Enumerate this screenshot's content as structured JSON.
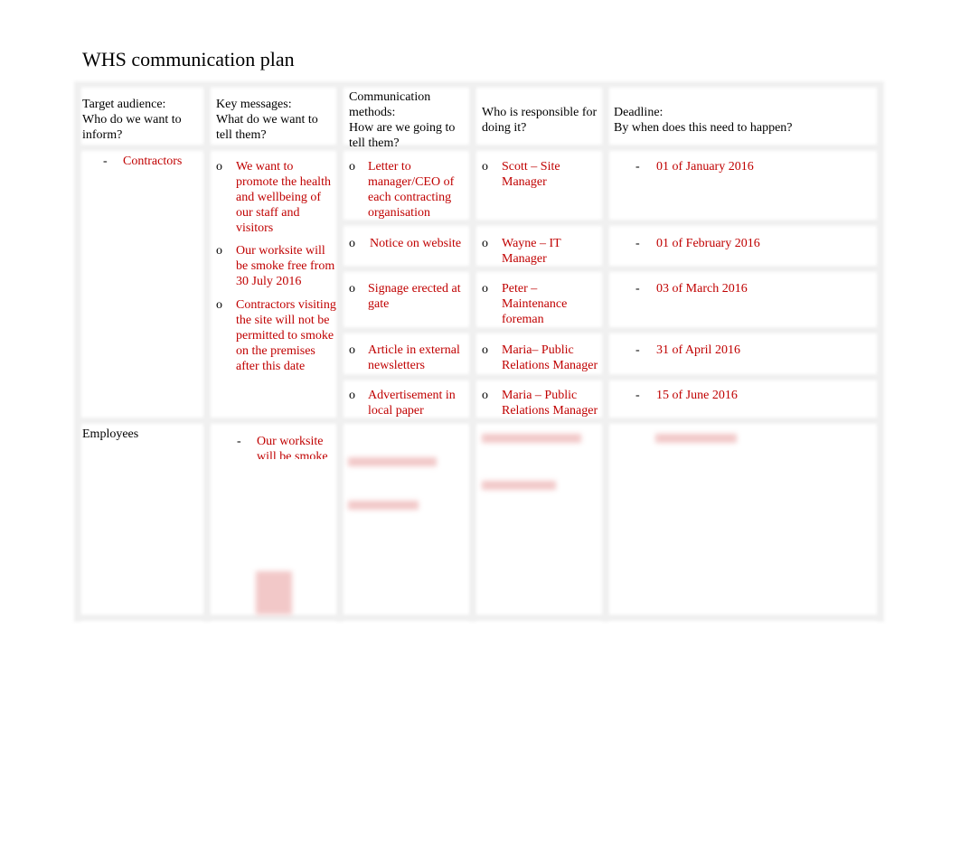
{
  "title": "WHS communication plan",
  "headers": [
    {
      "l1": "Target audience:",
      "l2": "Who do we want to inform?"
    },
    {
      "l1": "Key messages:",
      "l2": "What do we want to tell them?"
    },
    {
      "l1": "Communication methods:",
      "l2": "How are we going to tell them?"
    },
    {
      "l1": "Who is responsible for doing it?",
      "l2": ""
    },
    {
      "l1": "Deadline:",
      "l2": "By when does this need to happen?"
    }
  ],
  "bullets": {
    "dash": "-",
    "circle": "o"
  },
  "rows": [
    {
      "audience": "Contractors",
      "messages": [
        "We want to promote the health and wellbeing of our staff and visitors",
        "Our worksite will be smoke free from 30 July 2016",
        "Contractors visiting the site will not be permitted to smoke on the premises after this date"
      ],
      "actions": [
        {
          "method": "Letter to manager/CEO of each contracting organisation",
          "who": "Scott – Site Manager",
          "deadline": "01 of January 2016"
        },
        {
          "method": "Notice on website",
          "who": "Wayne – IT Manager",
          "deadline": "01 of February 2016"
        },
        {
          "method": "Signage erected at gate",
          "who": "Peter – Maintenance foreman",
          "deadline": "03 of March 2016"
        },
        {
          "method": "Article in external newsletters",
          "who": "Maria– Public Relations Manager",
          "deadline": "31 of April 2016"
        },
        {
          "method": "Advertisement in local paper",
          "who": "Maria – Public Relations Manager",
          "deadline": "15 of June 2016"
        }
      ]
    },
    {
      "audience": "Employees",
      "messages": [
        "Our worksite will be smoke"
      ]
    }
  ],
  "colors": {
    "text_accent": "#c00000"
  }
}
